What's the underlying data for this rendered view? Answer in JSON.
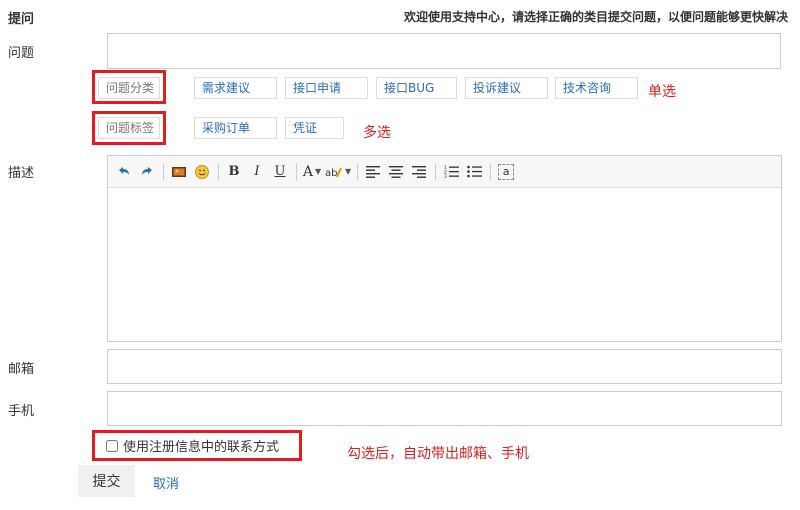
{
  "header": {
    "title": "提问",
    "welcome": "欢迎使用支持中心，请选择正确的类目提交问题，以便问题能够更快解决"
  },
  "form": {
    "question_label": "问题",
    "question_value": "",
    "category_label": "问题分类",
    "categories": [
      "需求建议",
      "接口申请",
      "接口BUG",
      "投诉建议",
      "技术咨询"
    ],
    "category_note": "单选",
    "tag_label": "问题标签",
    "tags": [
      "采购订单",
      "凭证"
    ],
    "tag_note": "多选",
    "description_label": "描述",
    "email_label": "邮箱",
    "email_value": "",
    "phone_label": "手机",
    "phone_value": "",
    "use_registered_label": "使用注册信息中的联系方式",
    "use_registered_checked": false,
    "use_registered_note": "勾选后，自动带出邮箱、手机",
    "submit_label": "提交",
    "cancel_label": "取消"
  },
  "toolbar": {
    "bold": "B",
    "italic": "I",
    "underline": "U",
    "font_color": "A",
    "source": "a"
  },
  "colors": {
    "accent": "#2a6dbd",
    "highlight": "#e11d1d"
  }
}
